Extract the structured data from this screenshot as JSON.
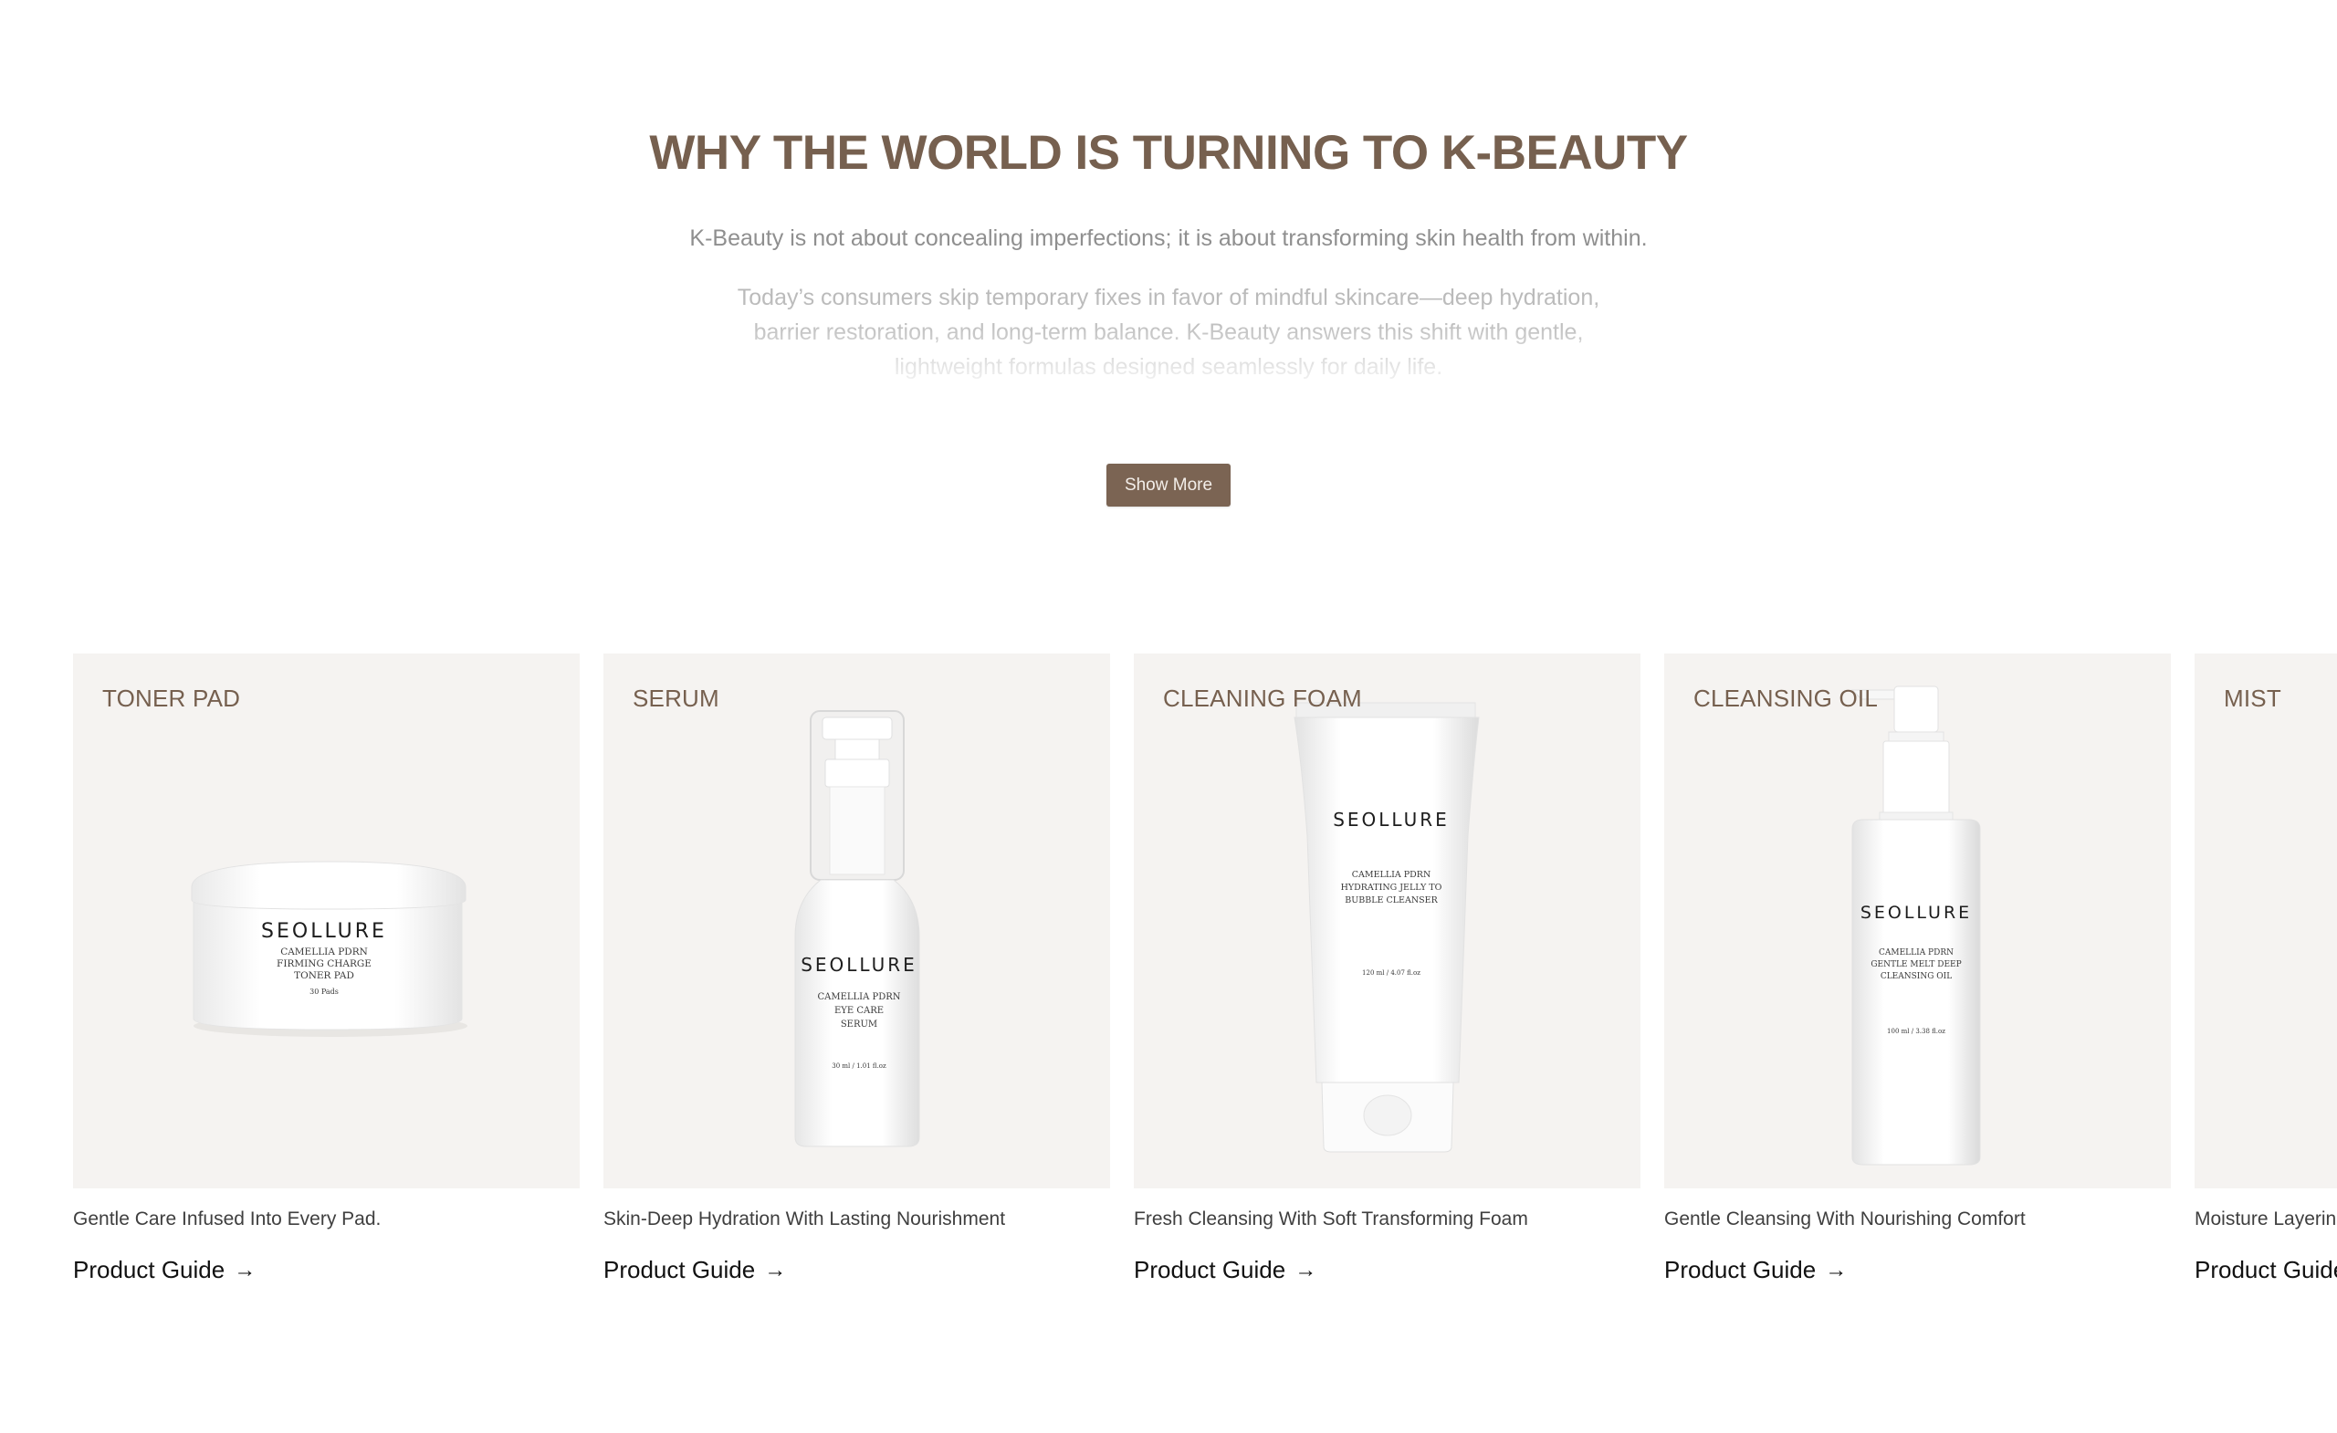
{
  "hero": {
    "title": "WHY THE WORLD IS TURNING TO K-BEAUTY",
    "lead": "K-Beauty is not about concealing imperfections; it is about transforming skin health from within.",
    "body": "Today’s consumers skip temporary fixes in favor of mindful skincare—deep hydration, barrier restoration, and long-term balance. K-Beauty answers this shift with gentle, lightweight formulas designed seamlessly for daily life.",
    "show_more_label": "Show More"
  },
  "products": [
    {
      "category": "TONER PAD",
      "description": "Gentle Care Infused Into Every Pad.",
      "link_label": "Product Guide",
      "packaging": {
        "brand": "SEOLLURE",
        "lines": [
          "CAMELLIA PDRN",
          "FIRMING CHARGE",
          "TONER PAD"
        ],
        "size": "30 Pads"
      }
    },
    {
      "category": "SERUM",
      "description": "Skin-Deep Hydration With Lasting Nourishment",
      "link_label": "Product Guide",
      "packaging": {
        "brand": "SEOLLURE",
        "lines": [
          "CAMELLIA PDRN",
          "EYE CARE",
          "SERUM"
        ],
        "size": "30 ml / 1.01 fl.oz"
      }
    },
    {
      "category": "CLEANING FOAM",
      "description": "Fresh Cleansing With Soft Transforming Foam",
      "link_label": "Product Guide",
      "packaging": {
        "brand": "SEOLLURE",
        "lines": [
          "CAMELLIA PDRN",
          "HYDRATING JELLY TO",
          "BUBBLE CLEANSER"
        ],
        "size": "120 ml / 4.07 fl.oz"
      }
    },
    {
      "category": "CLEANSING OIL",
      "description": "Gentle Cleansing With Nourishing Comfort",
      "link_label": "Product Guide",
      "packaging": {
        "brand": "SEOLLURE",
        "lines": [
          "CAMELLIA PDRN",
          "GENTLE MELT DEEP",
          "CLEANSING OIL"
        ],
        "size": "100 ml / 3.38 fl.oz"
      }
    },
    {
      "category": "MIST",
      "description": "Moisture Layering With Every Spritz",
      "link_label": "Product Guide"
    }
  ],
  "icons": {
    "link_arrow": "arrow-right-icon"
  },
  "colors": {
    "accent": "#76604f",
    "button_bg": "#7b6453",
    "card_bg": "#f5f3f1",
    "lead_text": "#8f8f8f",
    "body_text": "#b7b7b7"
  }
}
